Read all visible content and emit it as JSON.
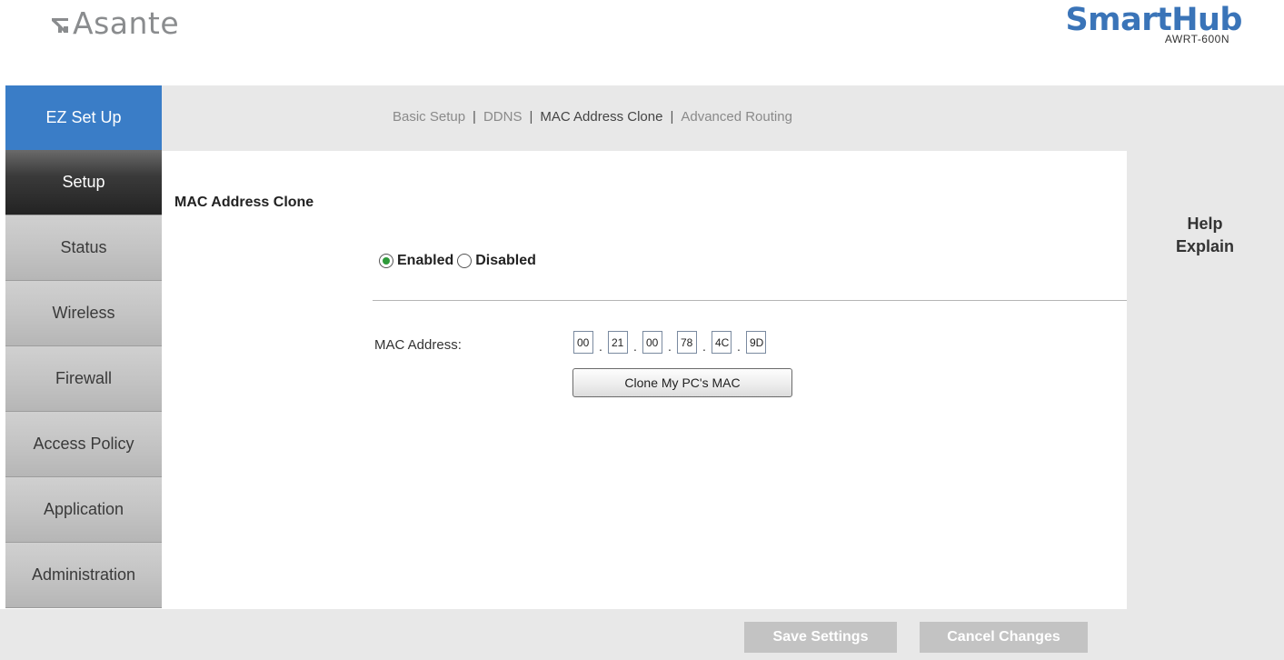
{
  "header": {
    "brand": "Asante",
    "product": "SmartHub",
    "model": "AWRT-600N"
  },
  "sidebar": {
    "items": [
      {
        "label": "EZ Set Up"
      },
      {
        "label": "Setup"
      },
      {
        "label": "Status"
      },
      {
        "label": "Wireless"
      },
      {
        "label": "Firewall"
      },
      {
        "label": "Access Policy"
      },
      {
        "label": "Application"
      },
      {
        "label": "Administration"
      }
    ],
    "active": "Setup"
  },
  "subnav": {
    "items": [
      "Basic Setup",
      "DDNS",
      "MAC Address Clone",
      "Advanced Routing"
    ],
    "separator": "|",
    "current": "MAC Address Clone"
  },
  "main": {
    "section_title": "MAC Address Clone",
    "radio": {
      "enabled_label": "Enabled",
      "disabled_label": "Disabled",
      "selected": "Enabled"
    },
    "mac": {
      "label": "MAC Address:",
      "octets": [
        "00",
        "21",
        "00",
        "78",
        "4C",
        "9D"
      ],
      "separator": "."
    },
    "clone_button": "Clone My PC's MAC"
  },
  "help": {
    "line1": "Help",
    "line2": "Explain"
  },
  "footer": {
    "save": "Save Settings",
    "cancel": "Cancel Changes"
  },
  "colors": {
    "accent_blue": "#3a7dc7",
    "brand_grey": "#8a8c8e",
    "product_blue": "#3a74b8",
    "radio_green": "#2e9a3a"
  }
}
